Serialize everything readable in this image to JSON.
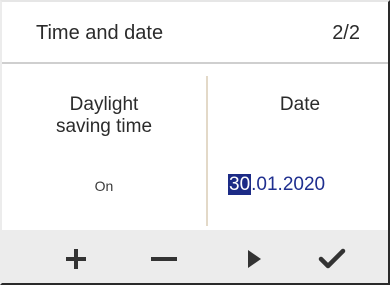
{
  "header": {
    "title": "Time and date",
    "page_indicator": "2/2"
  },
  "left_column": {
    "label_line1": "Daylight",
    "label_line2": "saving time",
    "value": "On"
  },
  "right_column": {
    "label": "Date",
    "date_day": "30",
    "date_rest": ".01.2020"
  },
  "toolbar": {
    "buttons": [
      {
        "icon": "plus-icon"
      },
      {
        "icon": "minus-icon"
      },
      {
        "icon": "play-icon"
      },
      {
        "icon": "checkmark-icon"
      }
    ],
    "icon_color": "#333333"
  },
  "colors": {
    "selection_bg": "#1c2b86",
    "date_text": "#1f2f8f",
    "toolbar_bg": "#ececec"
  }
}
